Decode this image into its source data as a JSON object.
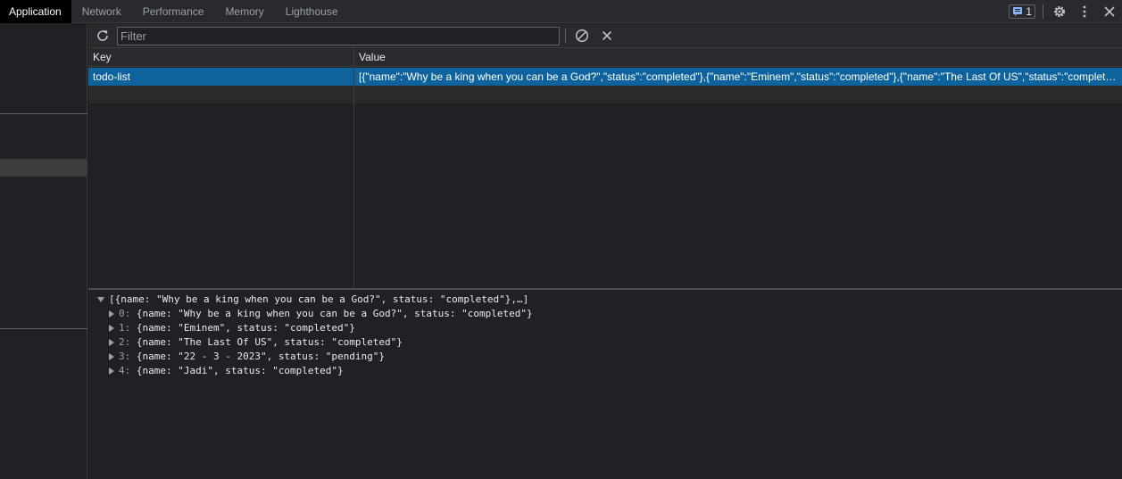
{
  "tabs": [
    {
      "label": "Application",
      "active": true
    },
    {
      "label": "Network",
      "active": false
    },
    {
      "label": "Performance",
      "active": false
    },
    {
      "label": "Memory",
      "active": false
    },
    {
      "label": "Lighthouse",
      "active": false
    }
  ],
  "issues_count": "1",
  "toolbar": {
    "filter_placeholder": "Filter",
    "filter_value": ""
  },
  "table": {
    "columns": [
      "Key",
      "Value"
    ],
    "rows": [
      {
        "key": "todo-list",
        "value": "[{\"name\":\"Why be a king when you can be a God?\",\"status\":\"completed\"},{\"name\":\"Eminem\",\"status\":\"completed\"},{\"name\":\"The Last Of US\",\"status\":\"completed\"},{\"name\":\"22 - 3 - 2023\",\"status\":\"pending\"},{\"name\":\"Jadi\",\"status\":\"completed\"}]"
      }
    ]
  },
  "preview": {
    "root": "[{name: \"Why be a king when you can be a God?\", status: \"completed\"},…]",
    "items": [
      {
        "index": "0:",
        "text": " {name: \"Why be a king when you can be a God?\", status: \"completed\"}"
      },
      {
        "index": "1:",
        "text": " {name: \"Eminem\", status: \"completed\"}"
      },
      {
        "index": "2:",
        "text": " {name: \"The Last Of US\", status: \"completed\"}"
      },
      {
        "index": "3:",
        "text": " {name: \"22 - 3 - 2023\", status: \"pending\"}"
      },
      {
        "index": "4:",
        "text": " {name: \"Jadi\", status: \"completed\"}"
      }
    ]
  },
  "colors": {
    "selected_row": "#0e639c",
    "background": "#202124",
    "toolbar": "#292a2d"
  },
  "icons": [
    "issues-icon",
    "settings-gear-icon",
    "more-vertical-icon",
    "close-icon",
    "refresh-icon",
    "clear-all-icon",
    "delete-selected-icon"
  ]
}
